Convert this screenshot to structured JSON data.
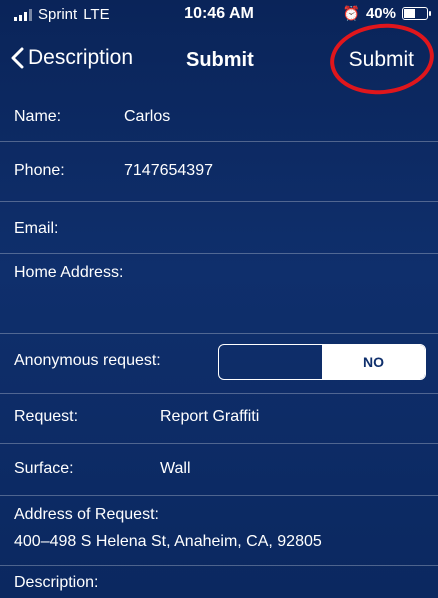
{
  "status_bar": {
    "carrier": "Sprint",
    "network": "LTE",
    "time": "10:46 AM",
    "battery": "40%"
  },
  "nav": {
    "back_label": "Description",
    "title": "Submit",
    "submit_label": "Submit"
  },
  "form": {
    "name_label": "Name:",
    "name_value": "Carlos",
    "phone_label": "Phone:",
    "phone_value": "7147654397",
    "email_label": "Email:",
    "home_label": "Home Address:",
    "anon_label": "Anonymous request:",
    "anon_options": [
      "",
      "NO"
    ],
    "anon_selected": "NO",
    "request_label": "Request:",
    "request_value": "Report Graffiti",
    "surface_label": "Surface:",
    "surface_value": "Wall",
    "address_label": "Address of Request:",
    "address_value": "400–498 S Helena St, Anaheim, CA, 92805",
    "description_label": "Description:"
  },
  "colors": {
    "background": "#0d2a66",
    "annotation": "#e0161c"
  }
}
